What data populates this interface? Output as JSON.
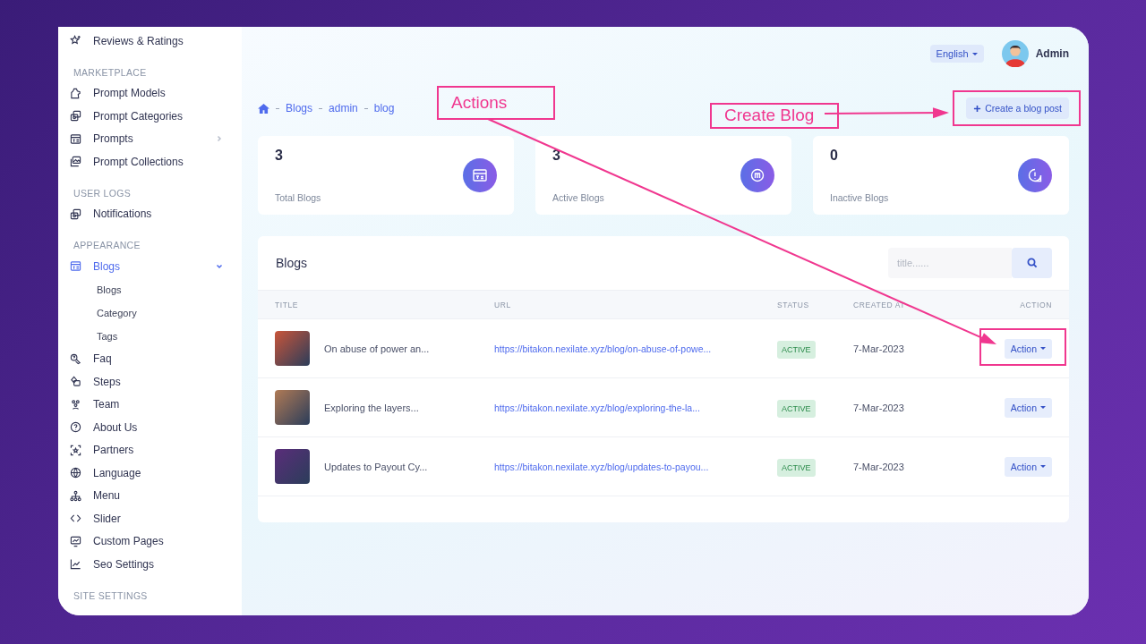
{
  "sidebar": {
    "sections": [
      {
        "items": [
          {
            "label": "Reviews & Ratings",
            "selected": false
          }
        ]
      },
      {
        "title": "MARKETPLACE",
        "items": [
          {
            "label": "Prompt Models",
            "selected": false
          },
          {
            "label": "Prompt Categories",
            "selected": false
          },
          {
            "label": "Prompts",
            "selected": false,
            "expanded": false
          },
          {
            "label": "Prompt Collections",
            "selected": false
          }
        ]
      },
      {
        "title": "USER LOGS",
        "items": [
          {
            "label": "Notifications",
            "selected": false
          }
        ]
      },
      {
        "title": "APPEARANCE",
        "items": [
          {
            "label": "Blogs",
            "selected": true,
            "expanded": true,
            "children": [
              {
                "label": "Blogs",
                "selected": false
              },
              {
                "label": "Category",
                "selected": false
              },
              {
                "label": "Tags",
                "selected": false
              }
            ]
          },
          {
            "label": "Faq",
            "selected": false
          },
          {
            "label": "Steps",
            "selected": false
          },
          {
            "label": "Team",
            "selected": false
          },
          {
            "label": "About Us",
            "selected": false
          },
          {
            "label": "Partners",
            "selected": false
          },
          {
            "label": "Language",
            "selected": false
          },
          {
            "label": "Menu",
            "selected": false
          },
          {
            "label": "Slider",
            "selected": false
          },
          {
            "label": "Custom Pages",
            "selected": false
          },
          {
            "label": "Seo Settings",
            "selected": false
          }
        ]
      },
      {
        "title": "SITE SETTINGS"
      }
    ]
  },
  "topbar": {
    "language": "English",
    "user": "Admin"
  },
  "breadcrumb": [
    "Blogs",
    "admin",
    "blog"
  ],
  "create_button": "Create a blog post",
  "stats": [
    {
      "value": "3",
      "label": "Total Blogs"
    },
    {
      "value": "3",
      "label": "Active Blogs"
    },
    {
      "value": "0",
      "label": "Inactive Blogs"
    }
  ],
  "table": {
    "title": "Blogs",
    "search": {
      "placeholder": "title......"
    },
    "columns": [
      "TITLE",
      "URL",
      "STATUS",
      "CREATED AT",
      "ACTION"
    ],
    "rows": [
      {
        "title": "On abuse of power an...",
        "url": "https://bitakon.nexilate.xyz/blog/on-abuse-of-powe...",
        "status": "ACTIVE",
        "created_at": "7-Mar-2023",
        "action": "Action"
      },
      {
        "title": "Exploring the layers...",
        "url": "https://bitakon.nexilate.xyz/blog/exploring-the-la...",
        "status": "ACTIVE",
        "created_at": "7-Mar-2023",
        "action": "Action"
      },
      {
        "title": "Updates to Payout Cy...",
        "url": "https://bitakon.nexilate.xyz/blog/updates-to-payou...",
        "status": "ACTIVE",
        "created_at": "7-Mar-2023",
        "action": "Action"
      }
    ]
  },
  "annotations": [
    {
      "kind": "callout",
      "text": "Actions"
    },
    {
      "kind": "callout",
      "text": "Create Blog"
    }
  ]
}
